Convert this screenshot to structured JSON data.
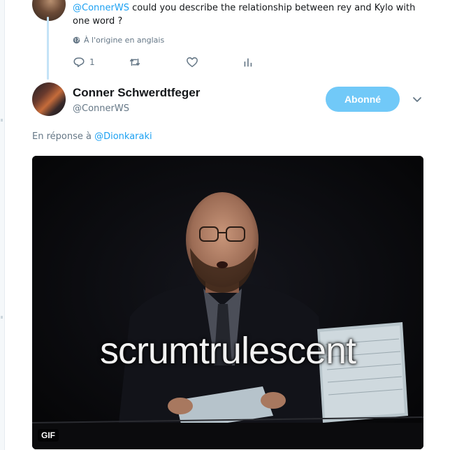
{
  "reply_tweet": {
    "mention": "@ConnerWS",
    "text": " could you describe the relationship between rey and Kylo  with one word ?",
    "translation_note": "À l'origine en anglais",
    "reply_count": "1"
  },
  "tweet": {
    "author_name": "Conner Schwerdtfeger",
    "author_handle": "@ConnerWS",
    "follow_label": "Abonné",
    "in_reply_prefix": "En réponse à ",
    "in_reply_mention": "@Dionkaraki",
    "media": {
      "caption": "scrumtrulescent",
      "badge": "GIF"
    }
  },
  "colors": {
    "link": "#1da1f2",
    "follow_button": "#71c9f8",
    "thread_line": "#c4e3f7",
    "muted_text": "#657786"
  },
  "icons": [
    "globe-icon",
    "reply-icon",
    "retweet-icon",
    "like-icon",
    "analytics-icon",
    "chevron-down-icon"
  ]
}
